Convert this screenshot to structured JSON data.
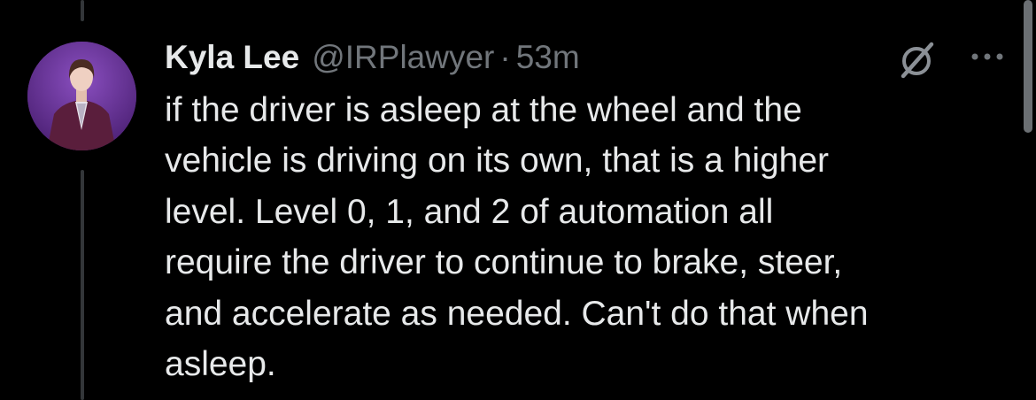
{
  "tweet": {
    "display_name": "Kyla Lee",
    "handle": "@IRPlawyer",
    "separator": "·",
    "time": "53m",
    "text_lines": [
      "if the driver is asleep at the wheel and the",
      "vehicle is driving on its own, that is a higher",
      "level. Level 0, 1, and 2 of automation all",
      "require the driver to continue to brake, steer,",
      "and accelerate as needed. Can't do that when",
      "asleep."
    ]
  },
  "icons": {
    "avatar": "profile-avatar",
    "grok": "grok-icon",
    "more": "more-icon"
  },
  "colors": {
    "background": "#000000",
    "text": "#e7e9ea",
    "secondary": "#71767b",
    "thread_line": "#333639"
  }
}
